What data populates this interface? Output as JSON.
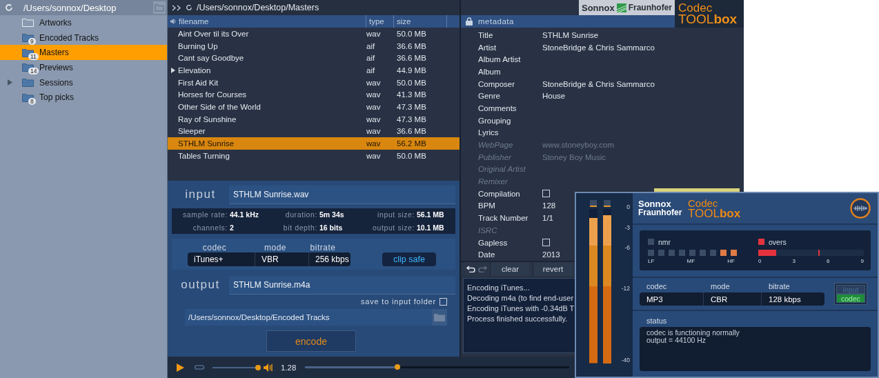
{
  "sidebar": {
    "path": "/Users/sonnox/Desktop",
    "items": [
      {
        "label": "Artworks",
        "empty": true,
        "expandable": false,
        "selected": false
      },
      {
        "label": "Encoded Tracks",
        "count": "9",
        "empty": false,
        "expandable": false,
        "selected": false
      },
      {
        "label": "Masters",
        "count": "11",
        "empty": false,
        "expandable": false,
        "selected": true
      },
      {
        "label": "Previews",
        "count": "14",
        "empty": false,
        "expandable": false,
        "selected": false
      },
      {
        "label": "Sessions",
        "empty": false,
        "expandable": true,
        "selected": false
      },
      {
        "label": "Top picks",
        "count": "8",
        "empty": false,
        "expandable": false,
        "selected": false
      }
    ]
  },
  "file_browser": {
    "path": "/Users/sonnox/Desktop/Masters",
    "columns": [
      "filename",
      "type",
      "size"
    ],
    "rows": [
      {
        "filename": "Aint Over til its Over",
        "type": "wav",
        "size": "50.0 MB",
        "expandable": false,
        "selected": false
      },
      {
        "filename": "Burning Up",
        "type": "aif",
        "size": "36.6 MB",
        "expandable": false,
        "selected": false
      },
      {
        "filename": "Cant say Goodbye",
        "type": "aif",
        "size": "36.6 MB",
        "expandable": false,
        "selected": false
      },
      {
        "filename": "Elevation",
        "type": "aif",
        "size": "44.9 MB",
        "expandable": true,
        "selected": false
      },
      {
        "filename": "First Aid Kit",
        "type": "wav",
        "size": "50.0 MB",
        "expandable": false,
        "selected": false
      },
      {
        "filename": "Horses for Courses",
        "type": "wav",
        "size": "41.3 MB",
        "expandable": false,
        "selected": false
      },
      {
        "filename": "Other Side of the World",
        "type": "wav",
        "size": "47.3 MB",
        "expandable": false,
        "selected": false
      },
      {
        "filename": "Ray of Sunshine",
        "type": "wav",
        "size": "47.3 MB",
        "expandable": false,
        "selected": false
      },
      {
        "filename": "Sleeper",
        "type": "wav",
        "size": "36.6 MB",
        "expandable": false,
        "selected": false
      },
      {
        "filename": "STHLM Sunrise",
        "type": "wav",
        "size": "56.2 MB",
        "expandable": false,
        "selected": true
      },
      {
        "filename": "Tables Turning",
        "type": "wav",
        "size": "50.0 MB",
        "expandable": false,
        "selected": false
      }
    ]
  },
  "encoder": {
    "input": {
      "label": "input",
      "value": "STHLM Sunrise.wav"
    },
    "info": [
      {
        "label": "sample rate:",
        "value": "44.1 kHz"
      },
      {
        "label": "duration:",
        "value": "5m 34s"
      },
      {
        "label": "input size:",
        "value": "56.1 MB"
      },
      {
        "label": "channels:",
        "value": "2"
      },
      {
        "label": "bit depth:",
        "value": "16 bits"
      },
      {
        "label": "output size:",
        "value": "10.1 MB"
      }
    ],
    "settings": [
      {
        "label": "codec",
        "value": "iTunes+"
      },
      {
        "label": "mode",
        "value": "VBR"
      },
      {
        "label": "bitrate",
        "value": "256 kbps"
      }
    ],
    "clip_safe": {
      "label": "clip safe",
      "on": true
    },
    "output": {
      "label": "output",
      "value": "STHLM Sunrise.m4a"
    },
    "save_to_input_folder": {
      "label": "save to input folder",
      "checked": false
    },
    "folder_path": "/Users/sonnox/Desktop/Encoded Tracks",
    "encode_button": "encode"
  },
  "transport": {
    "volume": {
      "level": 0.97
    },
    "time": "1.28"
  },
  "branding": {
    "brand": "Sonnox",
    "partner": "Fraunhofer",
    "product_line1": "Codec",
    "product_line2": "TOOL**box**"
  },
  "metadata": {
    "header": "metadata",
    "rows": [
      {
        "kind": "text",
        "label": "Title",
        "value": "STHLM Sunrise",
        "disabled": false
      },
      {
        "kind": "text",
        "label": "Artist",
        "value": "StoneBridge & Chris Sammarco",
        "disabled": false
      },
      {
        "kind": "text",
        "label": "Album Artist",
        "disabled": false
      },
      {
        "kind": "text",
        "label": "Album",
        "disabled": false
      },
      {
        "kind": "text",
        "label": "Composer",
        "value": "StoneBridge & Chris Sammarco",
        "disabled": false
      },
      {
        "kind": "text",
        "label": "Genre",
        "value": "House",
        "disabled": false
      },
      {
        "kind": "text",
        "label": "Comments",
        "disabled": false
      },
      {
        "kind": "text",
        "label": "Grouping",
        "disabled": false
      },
      {
        "kind": "text",
        "label": "Lyrics",
        "disabled": false
      },
      {
        "kind": "text",
        "label": "WebPage",
        "value": "www.stoneyboy.com",
        "disabled": true
      },
      {
        "kind": "text",
        "label": "Publisher",
        "value": "Stoney Boy Music",
        "disabled": true
      },
      {
        "kind": "text",
        "label": "Original Artist",
        "disabled": true
      },
      {
        "kind": "text",
        "label": "Remixer",
        "disabled": true
      },
      {
        "kind": "checkbox",
        "label": "Compilation",
        "checked": false,
        "disabled": false
      },
      {
        "kind": "text",
        "label": "BPM",
        "value": "128",
        "disabled": false
      },
      {
        "kind": "text",
        "label": "Track Number",
        "value": "1/1",
        "disabled": false
      },
      {
        "kind": "text",
        "label": "ISRC",
        "disabled": true
      },
      {
        "kind": "checkbox",
        "label": "Gapless",
        "checked": false,
        "disabled": false
      },
      {
        "kind": "text",
        "label": "Date",
        "value": "2013",
        "disabled": false
      }
    ],
    "actions": [
      "clear",
      "revert"
    ]
  },
  "log": [
    "Encoding iTunes...",
    "Decoding m4a (to find end-user",
    "Encoding iTunes with -0.34dB T",
    "Process finished successfully."
  ],
  "plugin": {
    "brand": "Sonnox",
    "partner": "Fraunhofer",
    "product_line1": "Codec",
    "product_line2": "TOOL**box**",
    "meters": [
      {
        "level": 0.94
      },
      {
        "level": 0.96
      }
    ],
    "scale": [
      "0",
      "-3",
      "-6",
      "-12",
      "-40"
    ],
    "nmr": {
      "label": "nmr",
      "on": false,
      "bands": [
        {
          "on": false
        },
        {
          "on": false
        },
        {
          "on": false
        },
        {
          "on": false
        },
        {
          "on": false
        },
        {
          "on": false
        },
        {
          "on": false
        },
        {
          "on": true
        },
        {
          "on": true
        }
      ],
      "band_labels": [
        "LF",
        "MF",
        "HF"
      ]
    },
    "overs": {
      "label": "overs",
      "on": true,
      "level": 0.17,
      "peak": {
        "level": 0.57
      },
      "ticks": [
        "0",
        "3",
        "6",
        "9"
      ]
    },
    "settings": [
      {
        "label": "codec",
        "value": "MP3"
      },
      {
        "label": "mode",
        "value": "CBR"
      },
      {
        "label": "bitrate",
        "value": "128 kbps"
      }
    ],
    "monitor": [
      {
        "label": "input",
        "selected": false
      },
      {
        "label": "codec",
        "selected": true
      }
    ],
    "status": {
      "label": "status",
      "lines": [
        "codec is functioning normally",
        "output = 44100 Hz"
      ]
    }
  }
}
